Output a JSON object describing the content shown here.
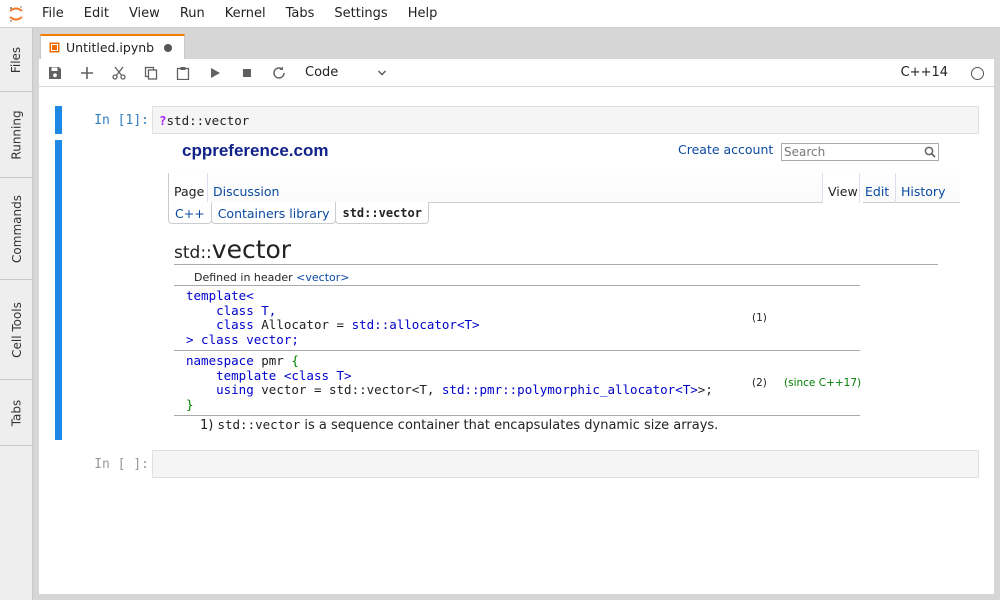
{
  "menu": [
    "File",
    "Edit",
    "View",
    "Run",
    "Kernel",
    "Tabs",
    "Settings",
    "Help"
  ],
  "sidebar": {
    "tabs": [
      "Files",
      "Running",
      "Commands",
      "Cell Tools",
      "Tabs"
    ]
  },
  "tab": {
    "title": "Untitled.ipynb"
  },
  "toolbar": {
    "cell_type": "Code",
    "kernel": "C++14"
  },
  "cells": {
    "first_prompt": "In [1]:",
    "first_q": "?",
    "first_code": "std::vector",
    "second_prompt": "In [ ]:"
  },
  "output": {
    "site": "cppreference.com",
    "create_account": "Create account",
    "search_placeholder": "Search",
    "left_tabs": [
      "Page",
      "Discussion"
    ],
    "right_tabs": [
      "View",
      "Edit",
      "History"
    ],
    "breadcrumbs": [
      "C++",
      "Containers library",
      "std::vector"
    ],
    "heading_ns": "std::",
    "heading_name": "vector",
    "defined_in": "Defined in header ",
    "header_name": "<vector>",
    "decl1": {
      "line1_kw": "template<",
      "line2": "class T,",
      "line3_kw": "class",
      "line3_a": " Allocator = ",
      "line3_b": "std::allocator<T>",
      "line4": "> class vector;",
      "num": "(1)"
    },
    "decl2": {
      "line1_kw": "namespace",
      "line1_a": " pmr ",
      "line1_b": "{",
      "line2": "template <class T>",
      "line3_kw": "using",
      "line3_a": " vector = std::vector<T, ",
      "line3_b": "std::pmr::polymorphic_allocator<T>",
      "line3_c": ">;",
      "line4": "}",
      "num": "(2)",
      "since": "(since C++17)"
    },
    "desc_num": "1) ",
    "desc_code": "std::vector",
    "desc_text": " is a sequence container that encapsulates dynamic size arrays."
  }
}
